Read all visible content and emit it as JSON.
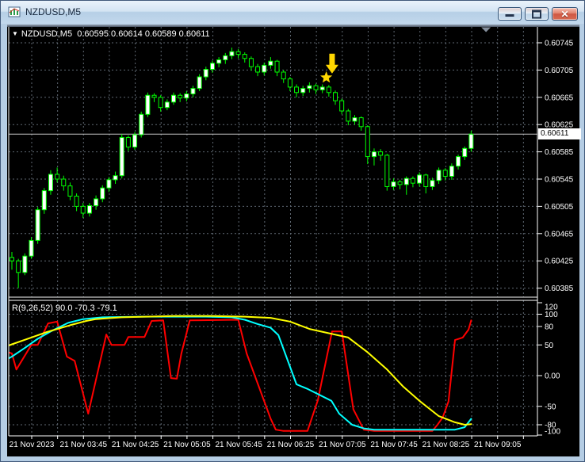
{
  "window": {
    "title": "NZDUSD,M5"
  },
  "icons": {
    "minimize": "minimize",
    "restore": "restore",
    "close": "✕",
    "dropdown": "▼",
    "arrow_marker": "⬇",
    "star_marker": "★",
    "shift_marker": "▾"
  },
  "header": {
    "dropdown_icon": "▼",
    "symbol": "NZDUSD,M5",
    "open": "0.60595",
    "high": "0.60614",
    "low": "0.60589",
    "close": "0.60611",
    "ohlc_text": "0.60595 0.60614 0.60589 0.60611"
  },
  "price_axis": {
    "ticks": [
      "0.60745",
      "0.60705",
      "0.60665",
      "0.60625",
      "0.60585",
      "0.60545",
      "0.60505",
      "0.60465",
      "0.60425",
      "0.60385"
    ],
    "current_price": "0.60611"
  },
  "indicator_panel": {
    "name": "R(9,26,52)",
    "values_text": "90.0 -70.3 -79.1",
    "ticks": [
      "120",
      "100",
      "80",
      "50",
      "0.00",
      "-50",
      "-80",
      "-100"
    ]
  },
  "time_axis": {
    "labels": [
      "21 Nov 2023",
      "21 Nov 03:45",
      "21 Nov 04:25",
      "21 Nov 05:05",
      "21 Nov 05:45",
      "21 Nov 06:25",
      "21 Nov 07:05",
      "21 Nov 07:45",
      "21 Nov 08:25",
      "21 Nov 09:05"
    ]
  },
  "colors": {
    "background": "#000000",
    "grid": "#5f6872",
    "candle_outline": "#00ff00",
    "bull_fill": "#ffffff",
    "bear_fill": "#000000",
    "axis_text": "#ffffff",
    "panel_border": "#ffffff",
    "current_price_line": "#c8c8c8",
    "marker": "#ffd700",
    "shift_marker": "#848e9c",
    "wpr_fast": "#ff0000",
    "wpr_mid": "#00ffff",
    "wpr_slow": "#ffff00"
  },
  "chart_data": {
    "type": "candlestick",
    "symbol": "NZDUSD",
    "timeframe": "M5",
    "price_unit": 1e-05,
    "y_axis": {
      "max": 0.60745,
      "min": 0.60385,
      "tick_step": 0.0004
    },
    "current_price": 0.60611,
    "ohlc": [
      [
        60430,
        60438,
        60412,
        60425
      ],
      [
        60425,
        60428,
        60385,
        60408
      ],
      [
        60408,
        60436,
        60404,
        60432
      ],
      [
        60432,
        60460,
        60428,
        60455
      ],
      [
        60455,
        60504,
        60450,
        60500
      ],
      [
        60500,
        60532,
        60494,
        60528
      ],
      [
        60528,
        60558,
        60522,
        60552
      ],
      [
        60552,
        60562,
        60540,
        60545
      ],
      [
        60545,
        60550,
        60528,
        60535
      ],
      [
        60535,
        60540,
        60514,
        60520
      ],
      [
        60520,
        60524,
        60498,
        60505
      ],
      [
        60505,
        60510,
        60488,
        60495
      ],
      [
        60495,
        60510,
        60490,
        60506
      ],
      [
        60506,
        60521,
        60500,
        60516
      ],
      [
        60516,
        60536,
        60511,
        60532
      ],
      [
        60532,
        60548,
        60526,
        60544
      ],
      [
        60544,
        60556,
        60538,
        60550
      ],
      [
        60550,
        60611,
        60546,
        60606
      ],
      [
        60606,
        60609,
        60586,
        60592
      ],
      [
        60592,
        60614,
        60588,
        60610
      ],
      [
        60610,
        60644,
        60606,
        60640
      ],
      [
        60640,
        60672,
        60636,
        60668
      ],
      [
        60668,
        60671,
        60658,
        60665
      ],
      [
        60665,
        60668,
        60644,
        60650
      ],
      [
        60650,
        60662,
        60646,
        60658
      ],
      [
        60658,
        60672,
        60654,
        60668
      ],
      [
        60668,
        60671,
        60658,
        60664
      ],
      [
        60664,
        60674,
        60659,
        60670
      ],
      [
        60670,
        60682,
        60665,
        60678
      ],
      [
        60678,
        60699,
        60674,
        60695
      ],
      [
        60695,
        60710,
        60690,
        60706
      ],
      [
        60706,
        60719,
        60701,
        60715
      ],
      [
        60715,
        60724,
        60709,
        60720
      ],
      [
        60720,
        60730,
        60714,
        60726
      ],
      [
        60726,
        60738,
        60721,
        60732
      ],
      [
        60732,
        60736,
        60722,
        60728
      ],
      [
        60728,
        60731,
        60716,
        60722
      ],
      [
        60722,
        60725,
        60704,
        60710
      ],
      [
        60710,
        60714,
        60696,
        60702
      ],
      [
        60702,
        60716,
        60697,
        60712
      ],
      [
        60712,
        60724,
        60707,
        60718
      ],
      [
        60718,
        60720,
        60696,
        60702
      ],
      [
        60702,
        60705,
        60686,
        60692
      ],
      [
        60692,
        60695,
        60674,
        60680
      ],
      [
        60680,
        60684,
        60665,
        60672
      ],
      [
        60672,
        60682,
        60667,
        60678
      ],
      [
        60678,
        60687,
        60672,
        60682
      ],
      [
        60682,
        60685,
        60670,
        60676
      ],
      [
        60676,
        60684,
        60671,
        60680
      ],
      [
        60680,
        60683,
        60666,
        60672
      ],
      [
        60672,
        60675,
        60654,
        60660
      ],
      [
        60660,
        60663,
        60640,
        60645
      ],
      [
        60645,
        60648,
        60624,
        60630
      ],
      [
        60630,
        60639,
        60625,
        60635
      ],
      [
        60635,
        60637,
        60616,
        60622
      ],
      [
        60622,
        60624,
        60567,
        60578
      ],
      [
        60578,
        60590,
        60565,
        60585
      ],
      [
        60585,
        60589,
        60572,
        60580
      ],
      [
        60580,
        60582,
        60528,
        60534
      ],
      [
        60534,
        60546,
        60529,
        60541
      ],
      [
        60541,
        60544,
        60530,
        60537
      ],
      [
        60537,
        60549,
        60522,
        60546
      ],
      [
        60546,
        60549,
        60533,
        60539
      ],
      [
        60539,
        60555,
        60534,
        60551
      ],
      [
        60551,
        60553,
        60524,
        60534
      ],
      [
        60534,
        60547,
        60529,
        60543
      ],
      [
        60543,
        60562,
        60538,
        60558
      ],
      [
        60558,
        60561,
        60543,
        60549
      ],
      [
        60549,
        60568,
        60544,
        60564
      ],
      [
        60564,
        60581,
        60559,
        60578
      ],
      [
        60578,
        60593,
        60573,
        60590
      ],
      [
        60590,
        60616,
        60585,
        60611
      ]
    ],
    "indicator": {
      "name": "R(9,26,52)",
      "axis": {
        "max": 120,
        "min": -100
      },
      "series": [
        {
          "name": "wpr-fast",
          "color": "#ff0000",
          "width": 2,
          "points": [
            [
              -0.5,
              38
            ],
            [
              0,
              36
            ],
            [
              0.7,
              10
            ],
            [
              3,
              50
            ],
            [
              4,
              50
            ],
            [
              5.6,
              85
            ],
            [
              7,
              88
            ],
            [
              8.5,
              31
            ],
            [
              9.7,
              24
            ],
            [
              11.8,
              -62
            ],
            [
              14.6,
              67
            ],
            [
              15.4,
              50
            ],
            [
              17.4,
              50
            ],
            [
              18,
              63
            ],
            [
              20.5,
              63
            ],
            [
              21.6,
              89
            ],
            [
              23.4,
              90
            ],
            [
              24.6,
              -4
            ],
            [
              25.5,
              -5
            ],
            [
              26.2,
              36
            ],
            [
              27.5,
              90
            ],
            [
              35,
              91
            ],
            [
              36.3,
              36
            ],
            [
              40,
              -70
            ],
            [
              40.8,
              -88
            ],
            [
              42,
              -90
            ],
            [
              45.7,
              -90
            ],
            [
              47.3,
              -40
            ],
            [
              49.5,
              72
            ],
            [
              51,
              72
            ],
            [
              52.8,
              -55
            ],
            [
              54.4,
              -88
            ],
            [
              56,
              -90
            ],
            [
              65,
              -90
            ],
            [
              65.8,
              -80
            ],
            [
              66.6,
              -68
            ],
            [
              67.5,
              -42
            ],
            [
              68.5,
              58
            ],
            [
              69.7,
              62
            ],
            [
              70.6,
              75
            ],
            [
              71,
              90
            ]
          ]
        },
        {
          "name": "wpr-mid",
          "color": "#00ffff",
          "width": 2,
          "points": [
            [
              -0.5,
              28
            ],
            [
              0,
              31
            ],
            [
              2,
              45
            ],
            [
              4,
              60
            ],
            [
              6,
              72
            ],
            [
              8.7,
              86
            ],
            [
              11,
              92
            ],
            [
              14,
              95
            ],
            [
              20,
              96
            ],
            [
              30,
              96
            ],
            [
              34,
              95
            ],
            [
              36,
              91
            ],
            [
              38,
              84
            ],
            [
              40,
              78
            ],
            [
              41.2,
              66
            ],
            [
              44,
              -14
            ],
            [
              45.8,
              -22
            ],
            [
              49.4,
              -41
            ],
            [
              50.6,
              -62
            ],
            [
              52.6,
              -80
            ],
            [
              54.4,
              -86
            ],
            [
              56,
              -88
            ],
            [
              68.5,
              -88
            ],
            [
              70,
              -84
            ],
            [
              71,
              -70.3
            ]
          ]
        },
        {
          "name": "wpr-slow",
          "color": "#ffff00",
          "width": 2,
          "points": [
            [
              -0.5,
              49
            ],
            [
              0,
              51
            ],
            [
              3,
              62
            ],
            [
              5.4,
              71
            ],
            [
              9,
              82
            ],
            [
              11.5,
              89
            ],
            [
              13,
              92
            ],
            [
              17,
              95
            ],
            [
              25,
              97
            ],
            [
              31,
              97
            ],
            [
              36,
              96
            ],
            [
              40,
              94
            ],
            [
              43,
              88
            ],
            [
              46,
              76
            ],
            [
              52,
              62
            ],
            [
              55,
              38
            ],
            [
              58,
              10
            ],
            [
              60.5,
              -18
            ],
            [
              63,
              -41
            ],
            [
              66,
              -66
            ],
            [
              68.5,
              -76
            ],
            [
              70,
              -80
            ],
            [
              71,
              -79.1
            ]
          ]
        }
      ]
    },
    "markers": [
      {
        "type": "arrow-down",
        "bar": 49.5,
        "price": 60700,
        "color": "#ffd700"
      },
      {
        "type": "star",
        "bar": 48.6,
        "price": 60694,
        "color": "#ffd700"
      }
    ],
    "shift_marker_bar": 73.3
  }
}
